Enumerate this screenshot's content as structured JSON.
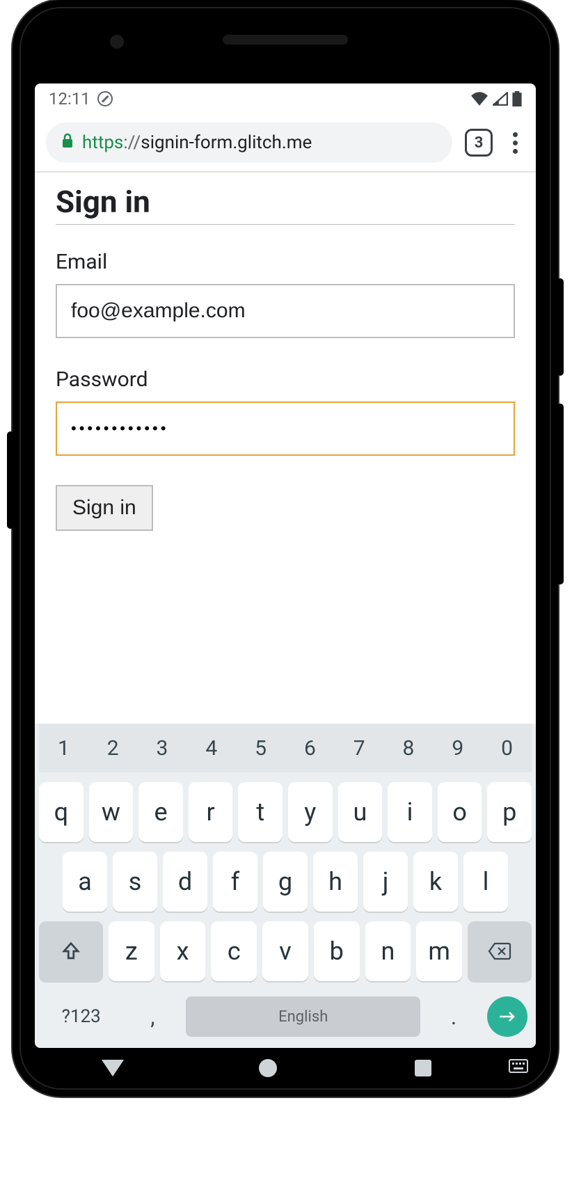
{
  "status_bar": {
    "time": "12:11"
  },
  "browser": {
    "url_scheme": "https",
    "url_sep": "://",
    "url_host": "signin-form.glitch.me",
    "tab_count": "3"
  },
  "form": {
    "title": "Sign in",
    "email_label": "Email",
    "email_value": "foo@example.com",
    "password_label": "Password",
    "password_masked": "••••••••••••",
    "submit_label": "Sign in"
  },
  "keyboard": {
    "numbers": [
      "1",
      "2",
      "3",
      "4",
      "5",
      "6",
      "7",
      "8",
      "9",
      "0"
    ],
    "row1": [
      "q",
      "w",
      "e",
      "r",
      "t",
      "y",
      "u",
      "i",
      "o",
      "p"
    ],
    "row2": [
      "a",
      "s",
      "d",
      "f",
      "g",
      "h",
      "j",
      "k",
      "l"
    ],
    "row3": [
      "z",
      "x",
      "c",
      "v",
      "b",
      "n",
      "m"
    ],
    "symbols_key": "?123",
    "comma_key": ",",
    "space_label": "English",
    "period_key": "."
  }
}
